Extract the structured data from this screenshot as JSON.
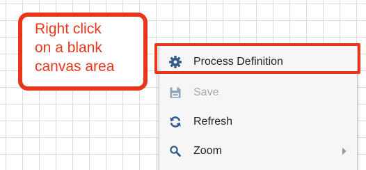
{
  "callout": {
    "lines": [
      "Right click",
      "on a blank",
      "canvas area"
    ]
  },
  "context_menu": {
    "items": [
      {
        "label": "Process Definition",
        "icon": "gear-icon",
        "enabled": true,
        "highlighted": true
      },
      {
        "label": "Save",
        "icon": "save-icon",
        "enabled": false
      },
      {
        "label": "Refresh",
        "icon": "refresh-icon",
        "enabled": true
      },
      {
        "label": "Zoom",
        "icon": "zoom-icon",
        "enabled": true,
        "submenu": true
      }
    ]
  },
  "colors": {
    "accent": "#e8361d",
    "icon_blue": "#2f5a8a",
    "disabled": "#a9a9a9",
    "grid": "#dcdcdc"
  }
}
